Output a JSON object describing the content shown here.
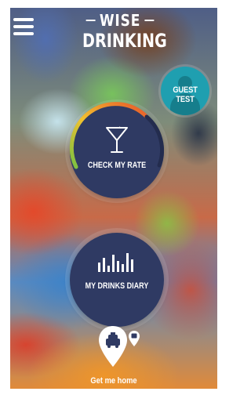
{
  "header": {
    "menu_icon": "hamburger-icon",
    "logo_line1": "WISE",
    "logo_line2": "DRINKING"
  },
  "guest_button": {
    "label": "GUEST TEST",
    "icon": "person-icon",
    "color": "#1f9fb0"
  },
  "rate_button": {
    "label": "CHECK MY RATE",
    "icon": "martini-glass-icon",
    "gauge_colors": [
      "#7ac142",
      "#f2c12e",
      "#e8552a"
    ]
  },
  "diary_button": {
    "label": "MY DRINKS DIARY",
    "icon": "bar-levels-icon"
  },
  "home_link": {
    "label": "Get me home",
    "icon": "taxi-pin-icon",
    "secondary_icon": "bus-pin-icon"
  },
  "colors": {
    "button_navy": "#2f3a63",
    "text": "#ffffff"
  }
}
